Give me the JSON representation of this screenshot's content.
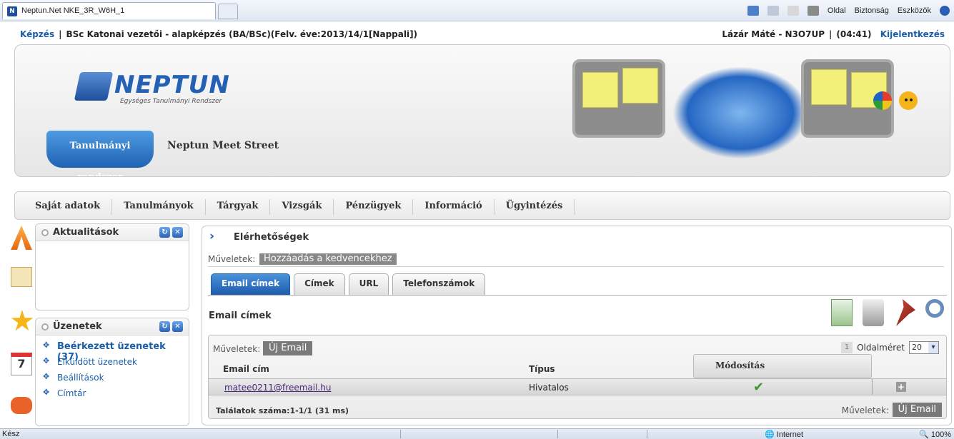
{
  "browser": {
    "tab_title": "Neptun.Net NKE_3R_W6H_1",
    "favicon_label": "N",
    "toolbar": {
      "page": "Oldal",
      "security": "Biztonság",
      "tools": "Eszközök"
    }
  },
  "info": {
    "kepzes": "Képzés",
    "program": "BSc Katonai vezetői - alapképzés (BA/BSc)(Felv. éve:2013/14/1[Nappali])",
    "user": "Lázár Máté - N3O7UP",
    "timer": "(04:41)",
    "logout": "Kijelentkezés"
  },
  "header": {
    "logo_name": "NEPTUN",
    "logo_sub": "Egységes Tanulmányi Rendszer",
    "tab_active": "Tanulmányi rendszer",
    "tab_other": "Neptun Meet Street"
  },
  "menu": [
    "Saját adatok",
    "Tanulmányok",
    "Tárgyak",
    "Vizsgák",
    "Pénzügyek",
    "Információ",
    "Ügyintézés"
  ],
  "panels": {
    "news": {
      "title": "Aktualitások"
    },
    "messages": {
      "title": "Üzenetek",
      "items": [
        "Beérkezett üzenetek (37)",
        "Elküldött üzenetek",
        "Beállítások",
        "Címtár"
      ]
    }
  },
  "main": {
    "title": "Elérhetőségek",
    "ops_label": "Műveletek:",
    "add_fav": "Hozzáadás a kedvencekhez",
    "tabs": [
      "Email címek",
      "Címek",
      "URL",
      "Telefonszámok"
    ],
    "section_title": "Email címek",
    "grid": {
      "ops_label": "Műveletek:",
      "new_email": "Új Email",
      "page_num": "1",
      "page_size_label": "Oldalméret",
      "page_size": "20",
      "col_email": "Email cím",
      "col_type": "Típus",
      "col_mod": "Módosítás",
      "row": {
        "email": "matee0211@freemail.hu",
        "type": "Hivatalos",
        "check": "✔",
        "add": "+"
      },
      "count": "Találatok száma:1-1/1 (31 ms)"
    }
  },
  "status": {
    "left": "Kész",
    "zone": "Internet",
    "zoom": "100%"
  }
}
